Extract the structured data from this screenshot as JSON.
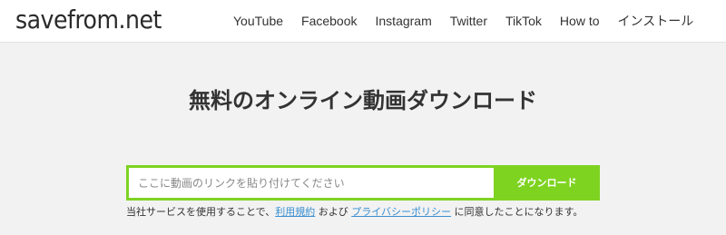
{
  "header": {
    "logo": "savefrom.net",
    "nav": [
      "YouTube",
      "Facebook",
      "Instagram",
      "Twitter",
      "TikTok",
      "How to",
      "インストール"
    ]
  },
  "main": {
    "title": "無料のオンライン動画ダウンロード",
    "url_placeholder": "ここに動画のリンクを貼り付けてください",
    "download_button": "ダウンロード",
    "terms": {
      "prefix": "当社サービスを使用することで、",
      "terms_link": "利用規約",
      "middle": " および ",
      "privacy_link": "プライバシーポリシー",
      "suffix": " に同意したことになります。"
    }
  },
  "colors": {
    "accent_green": "#7ed321",
    "link_blue": "#3a8fd1",
    "background": "#f2f2f2"
  }
}
